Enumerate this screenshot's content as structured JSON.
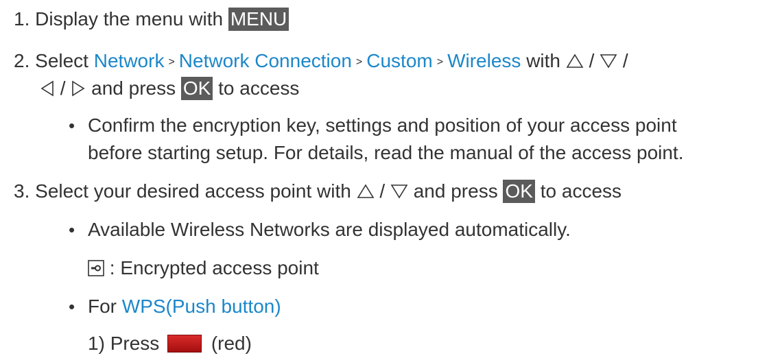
{
  "steps": {
    "step1": {
      "number": "1.",
      "text": "Display the menu with",
      "key": "MENU"
    },
    "step2": {
      "number": "2.",
      "prefix": "Select",
      "path": [
        "Network",
        "Network Connection",
        "Custom",
        "Wireless"
      ],
      "separator": ">",
      "with_text": "with",
      "slash": "/",
      "and_press": "and press",
      "key": "OK",
      "suffix": "to access",
      "bullet": "•",
      "note_line1": "Confirm the encryption key, settings and position of your access point",
      "note_line2": "before starting setup. For details, read the manual of the access point."
    },
    "step3": {
      "number": "3.",
      "text": "Select your desired access point with",
      "slash": "/",
      "and_press": "and press",
      "key": "OK",
      "suffix": "to access",
      "bullet": "•",
      "note_available": "Available Wireless Networks are displayed automatically.",
      "encrypted_label": ": Encrypted access point",
      "wps_prefix": "For",
      "wps_link": "WPS(Push button)",
      "sub_number": "1)",
      "sub_text": "Press",
      "sub_suffix": "(red)"
    }
  },
  "icons": {
    "up": "up-triangle-icon",
    "down": "down-triangle-icon",
    "left": "left-triangle-icon",
    "right": "right-triangle-icon",
    "lock": "encrypted-lock-icon",
    "red": "red-button-icon"
  },
  "colors": {
    "text": "#333333",
    "link": "#1b87c9",
    "key_bg": "#5b5b5b",
    "red_button": "#c01818"
  }
}
